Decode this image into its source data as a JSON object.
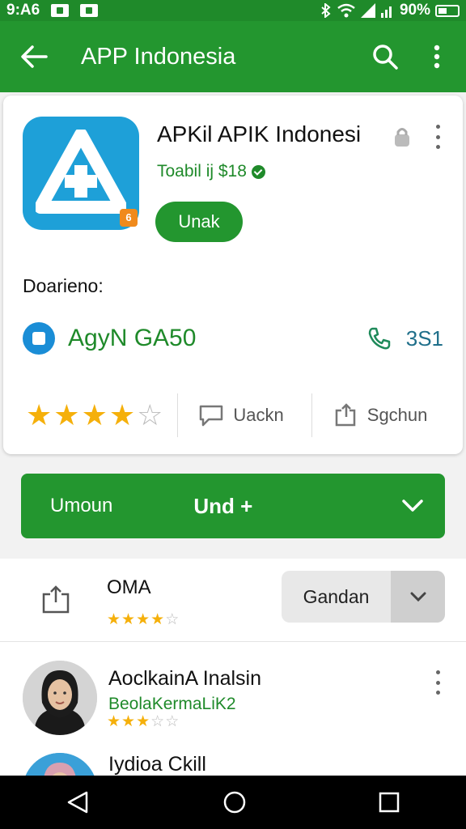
{
  "status_bar": {
    "time": "9:A6",
    "battery": "90%"
  },
  "app_bar": {
    "title": "APP Indonesia"
  },
  "app": {
    "name": "APKil APIK Indonesi",
    "subtitle": "Toabil ij $18",
    "badge": "6",
    "install_label": "Unak",
    "description_label": "Doarieno:",
    "developer_name": "AgyN GA50",
    "phone_value": "3S1",
    "rating": 3.5,
    "action_review": "Uackn",
    "action_share": "Sgchun"
  },
  "primary_button": {
    "left_label": "Umoun",
    "center_label": "Und +"
  },
  "list": {
    "row1": {
      "name": "OMA",
      "rating": 3.5,
      "button_label": "Gandan"
    },
    "row2": {
      "name": "AoclkainA Inalsin",
      "subtitle": "BeolaKermaLiK2",
      "rating": 2.5
    },
    "row3": {
      "name": "Iydioa Ckill"
    }
  },
  "colors": {
    "primary_green": "#23962f",
    "app_icon_blue": "#1ea0d8",
    "star": "#f5b00b"
  }
}
